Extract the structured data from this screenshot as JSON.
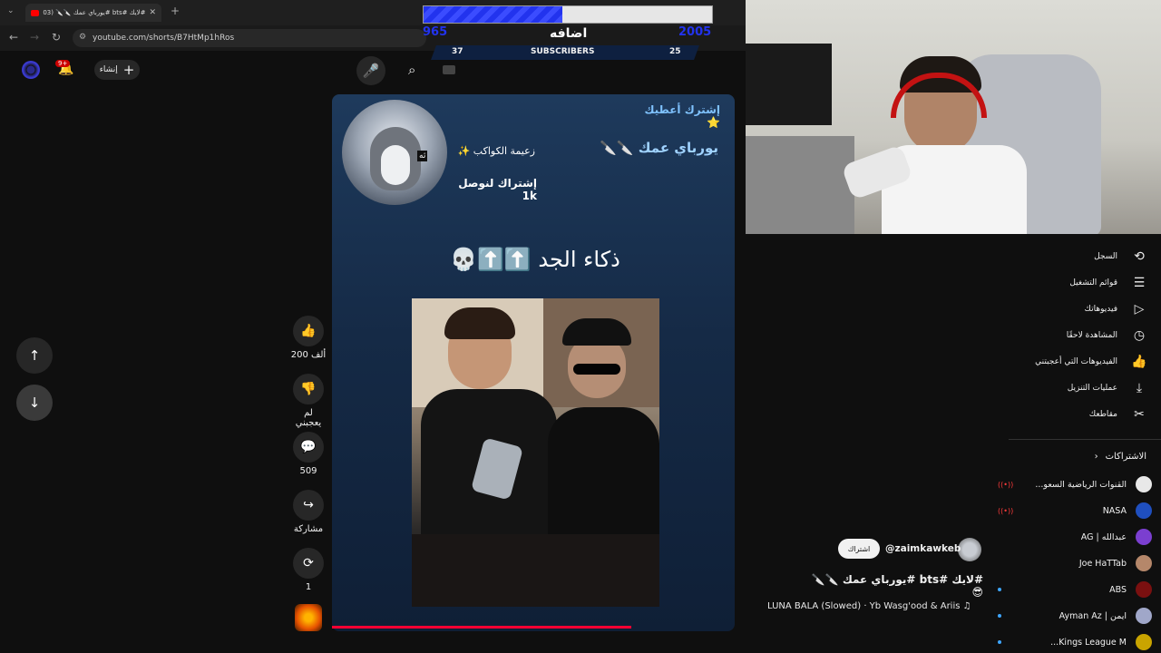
{
  "browser": {
    "tab_title": "#لايك #bts #يورباي عمك 🔪🔪 (2003) 🔊",
    "url": "youtube.com/shorts/B7HtMp1hRos"
  },
  "header": {
    "create_label": "إنشاء",
    "notification_count": "9+"
  },
  "overlay": {
    "left_value": "965",
    "center_label": "اضافه",
    "right_value": "2005",
    "progress": 0.48,
    "subs_left": "37",
    "subs_label": "SUBSCRIBERS",
    "subs_right": "25"
  },
  "short": {
    "top_right_line": "إشترك أعطيك ⭐",
    "name_line": "يورباي عمك 🔪🔪",
    "leader_line": "زعيمة الكواكب ✨",
    "goal_line": "إشتراك لنوصل 1k",
    "caption": "ذكاء الجد ⬆️⬆️💀",
    "penguin_badge": "ثه"
  },
  "actions": {
    "likes": "200 ألف",
    "dislike_label": "لم يعجبني",
    "comments": "509",
    "share_label": "مشاركة",
    "remix_count": "1"
  },
  "channel": {
    "handle": "@zaimkawkeb",
    "subscribe_label": "اشتراك",
    "title": "#لايك #bts #يورباي عمك 🔪🔪 😎",
    "music": "LUNA BALA (Slowed) · Yb Wasg'ood & Ariis ♫"
  },
  "sidebar": {
    "items": [
      {
        "label": "السجل",
        "icon": "history-icon"
      },
      {
        "label": "قوائم التشغيل",
        "icon": "playlist-icon"
      },
      {
        "label": "فيديوهاتك",
        "icon": "your-videos-icon"
      },
      {
        "label": "المشاهدة لاحقًا",
        "icon": "watch-later-icon"
      },
      {
        "label": "الفيديوهات التي أعجبتني",
        "icon": "liked-icon"
      },
      {
        "label": "عمليات التنزيل",
        "icon": "download-icon"
      },
      {
        "label": "مقاطعك",
        "icon": "clips-icon"
      }
    ],
    "subs_header": "الاشتراكات",
    "subscriptions": [
      {
        "name": "القنوات الرياضية السعو...",
        "live": true,
        "avatar_color": "#e8e8e8"
      },
      {
        "name": "NASA",
        "live": true,
        "avatar_color": "#1f4fbf"
      },
      {
        "name": "عبدالله | AG",
        "live": false,
        "avatar_color": "#7b3fd0"
      },
      {
        "name": "Joe HaTTab",
        "live": false,
        "avatar_color": "#b5876a"
      },
      {
        "name": "ABS",
        "live": false,
        "dot": true,
        "avatar_color": "#7a1010"
      },
      {
        "name": "ايمن | Ayman Az",
        "live": false,
        "dot": true,
        "avatar_color": "#a0a7c9"
      },
      {
        "name": "Kings League M...",
        "live": false,
        "dot": true,
        "avatar_color": "#c9a400"
      }
    ]
  }
}
